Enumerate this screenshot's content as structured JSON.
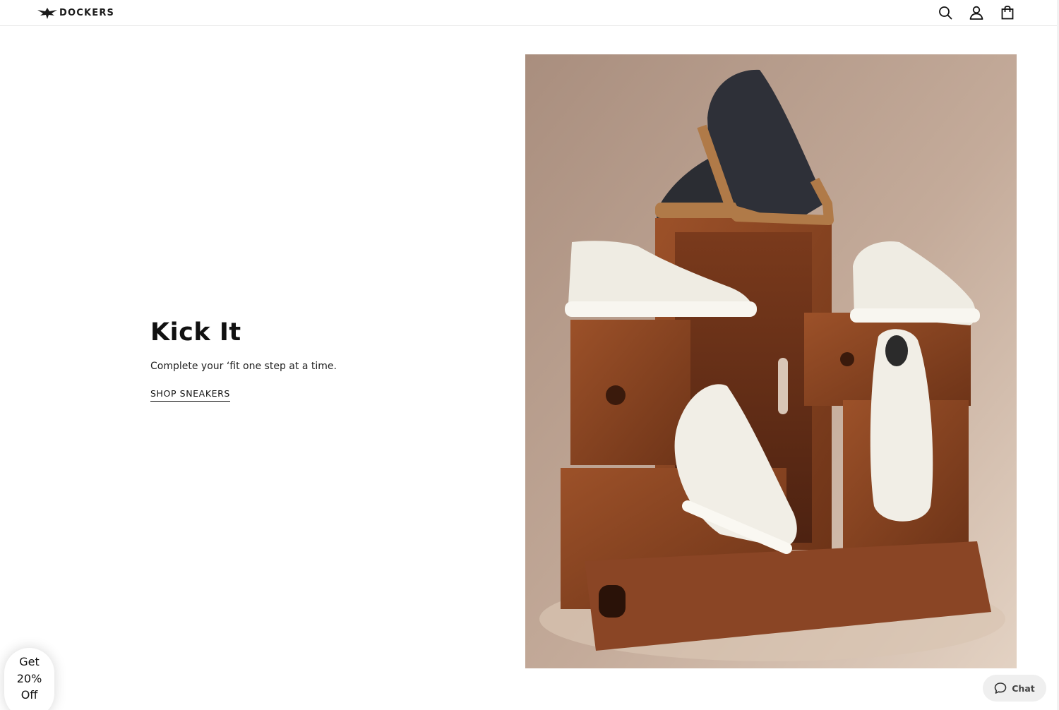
{
  "header": {
    "brand": "DOCKERS",
    "icons": [
      "search-icon",
      "account-icon",
      "shopping-bag-icon"
    ]
  },
  "hero": {
    "title": "Kick It",
    "subtitle": "Complete your ‘fit one step at a time.",
    "cta_label": "SHOP SNEAKERS"
  },
  "promo_badge": {
    "line1": "Get",
    "line2": "20%",
    "line3": "Off"
  },
  "chat": {
    "label": "Chat",
    "icon": "chat-bubble-icon"
  },
  "colors": {
    "image_background": "#b59a88",
    "crate_wood": "#8a4422",
    "dark_sneaker": "#2b2d33",
    "gum_sole": "#b07a48",
    "white_sneaker": "#efece3"
  }
}
